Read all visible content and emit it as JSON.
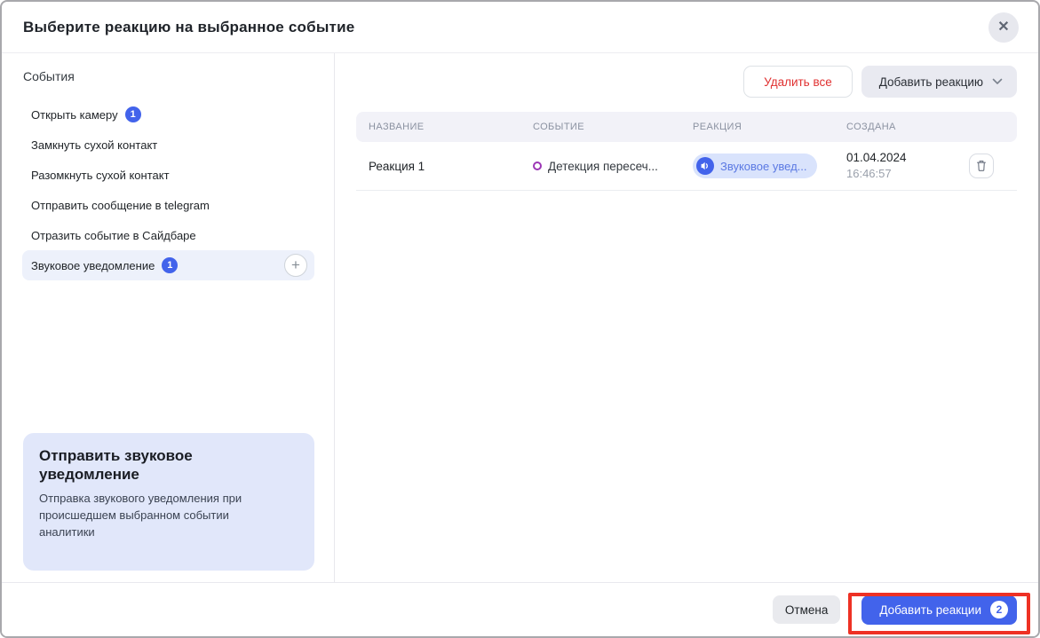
{
  "modal": {
    "title": "Выберите реакцию на выбранное событие"
  },
  "icons": {
    "close": "✕",
    "plus": "+"
  },
  "sidebar": {
    "heading": "События",
    "items": [
      {
        "label": "Открыть камеру",
        "badge": "1"
      },
      {
        "label": "Замкнуть сухой контакт"
      },
      {
        "label": "Разомкнуть сухой контакт"
      },
      {
        "label": "Отправить сообщение в telegram"
      },
      {
        "label": "Отразить событие в Сайдбаре"
      },
      {
        "label": "Звуковое уведомление",
        "badge": "1",
        "selected": true
      }
    ],
    "info_card": {
      "title": "Отправить звуковое уведомление",
      "description": "Отправка звукового уведомления при происшедшем выбранном событии аналитики"
    }
  },
  "toolbar": {
    "delete_all_label": "Удалить все",
    "add_reaction_label": "Добавить реакцию"
  },
  "table": {
    "columns": [
      "НАЗВАНИЕ",
      "СОБЫТИЕ",
      "РЕАКЦИЯ",
      "СОЗДАНА"
    ],
    "rows": [
      {
        "name": "Реакция 1",
        "event": "Детекция пересеч...",
        "reaction": "Звуковое увед...",
        "created_date": "01.04.2024",
        "created_time": "16:46:57"
      }
    ]
  },
  "footer": {
    "cancel_label": "Отмена",
    "submit_label": "Добавить реакции",
    "submit_badge": "2"
  },
  "colors": {
    "accent_blue": "#4263eb",
    "chip_bg": "#d9e3fc",
    "chip_text": "#5b79e3",
    "danger_red": "#e03131",
    "annotation_red": "#ee3124",
    "event_icon_purple": "#9c36b5",
    "selected_item_bg": "#edf1fb",
    "info_card_bg": "#e1e7fa"
  }
}
